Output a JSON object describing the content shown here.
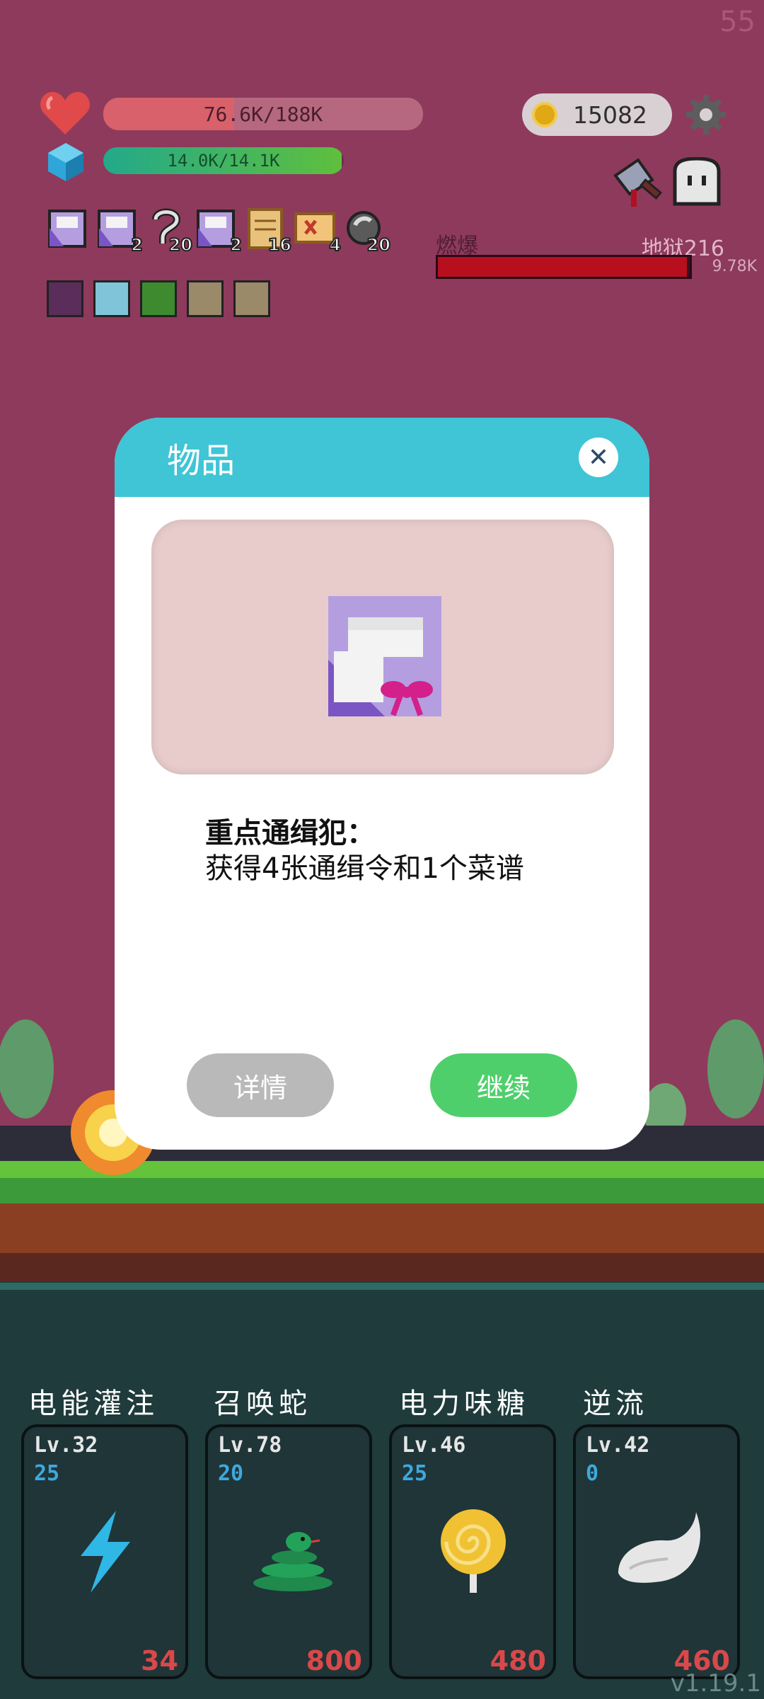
{
  "fps": "55",
  "hud": {
    "hp_text": "76.6K/188K",
    "hp_fraction": 0.41,
    "mp_text": "14.0K/14.1K",
    "mp_fraction": 0.99,
    "coins": "15082"
  },
  "inventory": [
    {
      "icon": "recipe-scroll-icon",
      "count": ""
    },
    {
      "icon": "recipe-scroll-icon",
      "count": "2"
    },
    {
      "icon": "hook-icon",
      "count": "20"
    },
    {
      "icon": "recipe-scroll-icon",
      "count": "2"
    },
    {
      "icon": "map-scroll-icon",
      "count": "16"
    },
    {
      "icon": "treasure-map-icon",
      "count": "4"
    },
    {
      "icon": "stone-icon",
      "count": "20"
    }
  ],
  "enemy": {
    "tag": "燃爆",
    "level": "地狱216",
    "hp": "9.78K",
    "hp_fraction": 0.99
  },
  "dialog": {
    "title": "物品",
    "item_name": "重点通缉犯：",
    "item_desc": "获得4张通缉令和1个菜谱",
    "details_label": "详情",
    "continue_label": "继续"
  },
  "skills": [
    {
      "name": "电能灌注",
      "level": "Lv.32",
      "count": "25",
      "cost": "34",
      "icon": "lightning-icon"
    },
    {
      "name": "召唤蛇",
      "level": "Lv.78",
      "count": "20",
      "cost": "800",
      "icon": "snake-icon"
    },
    {
      "name": "电力味糖",
      "level": "Lv.46",
      "count": "25",
      "cost": "480",
      "icon": "lollipop-icon"
    },
    {
      "name": "逆流",
      "level": "Lv.42",
      "count": "0",
      "cost": "460",
      "icon": "wing-icon"
    }
  ],
  "version": "v1.19.1",
  "colors": {
    "background": "#8e3a5c",
    "dialog_header": "#3fc5d6",
    "continue_button": "#4fcf6b",
    "details_button": "#b9b9b9",
    "cost_red": "#d9484a"
  }
}
